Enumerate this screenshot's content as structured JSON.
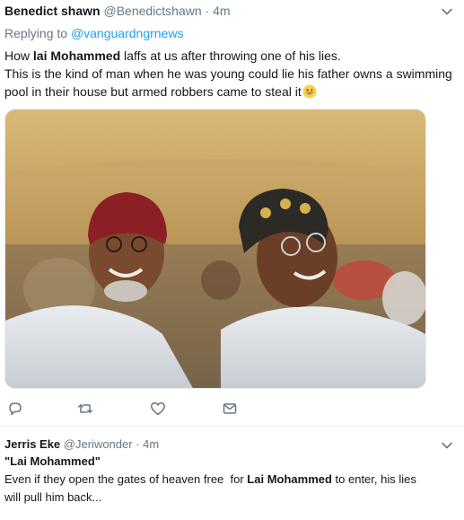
{
  "tweets": [
    {
      "name": "Benedict shawn",
      "handle": "@Benedictshawn",
      "dot": "·",
      "time": "4m",
      "replying_prefix": "Replying to ",
      "replying_handle": "@vanguardngrnews",
      "line1_a": "How ",
      "line1_bold": "lai Mohammed",
      "line1_b": " laffs at us after throwing one of his lies.",
      "line2": "This is the kind of man when he was young could lie his father owns a swimming",
      "line3": "pool in their house but armed robbers came to steal it",
      "emoji": "grinning-face-emoji",
      "actions": [
        "reply-icon",
        "retweet-icon",
        "like-icon",
        "direct-message-icon"
      ]
    },
    {
      "name": "Jerris Eke",
      "handle": "@Jeriwonder",
      "dot": "·",
      "time": "4m",
      "line1": "\"Lai Mohammed\"",
      "line2_a": "Even if they open the gates of heaven free  for ",
      "line2_bold": "Lai Mohammed",
      "line2_b": " to enter, his lies",
      "line3": "will pull him back..."
    }
  ],
  "colors": {
    "link": "#1da1f2",
    "muted": "#657786",
    "text": "#14171a",
    "divider": "#e6ecf0"
  }
}
